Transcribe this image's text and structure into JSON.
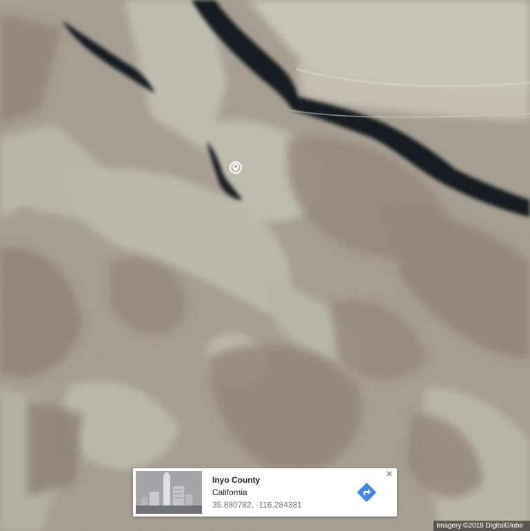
{
  "map": {
    "type": "satellite",
    "pin_icon": "location-pin-icon"
  },
  "place_card": {
    "title": "Inyo County",
    "subtitle": "California",
    "coordinates": "35.880782, -116.284381",
    "directions_icon": "directions-icon",
    "close_label": "×",
    "accent_color": "#4285f4"
  },
  "attribution": {
    "text": "Imagery ©2018 DigitalGlobe"
  }
}
